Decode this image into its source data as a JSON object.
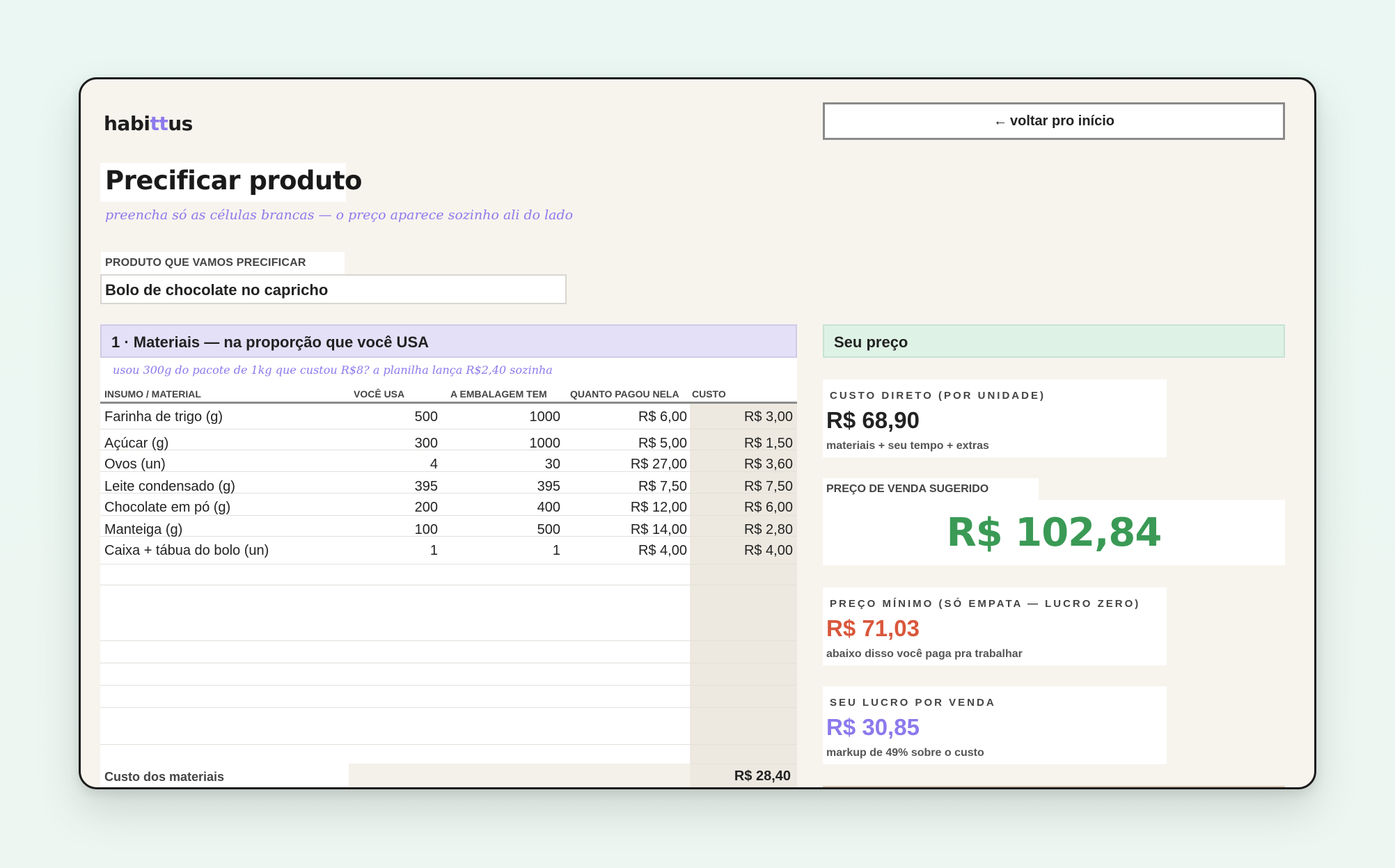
{
  "app": {
    "logo_prefix": "habi",
    "logo_highlight": "tt",
    "logo_suffix": "us",
    "back_button": "voltar pro início"
  },
  "page": {
    "title": "Precificar produto",
    "subtitle": "preencha só as células brancas — o preço aparece sozinho ali do lado"
  },
  "product": {
    "label": "PRODUTO QUE VAMOS PRECIFICAR",
    "value": "Bolo de chocolate no capricho"
  },
  "materials": {
    "heading": "1 · Materiais — na proporção que você USA",
    "hint": "usou 300g do pacote de 1kg que custou R$8? a planilha lança R$2,40 sozinha",
    "columns": {
      "insumo": "INSUMO / MATERIAL",
      "usa": "VOCÊ USA",
      "emb": "A EMBALAGEM TEM",
      "pago": "QUANTO PAGOU NELA",
      "custo": "CUSTO"
    },
    "rows": [
      {
        "name": "Farinha de trigo (g)",
        "usa": "500",
        "emb": "1000",
        "pago": "R$ 6,00",
        "custo": "R$ 3,00"
      },
      {
        "name": "Açúcar (g)",
        "usa": "300",
        "emb": "1000",
        "pago": "R$ 5,00",
        "custo": "R$ 1,50"
      },
      {
        "name": "Ovos (un)",
        "usa": "4",
        "emb": "30",
        "pago": "R$ 27,00",
        "custo": "R$ 3,60"
      },
      {
        "name": "Leite condensado (g)",
        "usa": "395",
        "emb": "395",
        "pago": "R$ 7,50",
        "custo": "R$ 7,50"
      },
      {
        "name": "Chocolate em pó (g)",
        "usa": "200",
        "emb": "400",
        "pago": "R$ 12,00",
        "custo": "R$ 6,00"
      },
      {
        "name": "Manteiga (g)",
        "usa": "100",
        "emb": "500",
        "pago": "R$ 14,00",
        "custo": "R$ 2,80"
      },
      {
        "name": "Caixa + tábua do bolo (un)",
        "usa": "1",
        "emb": "1",
        "pago": "R$ 4,00",
        "custo": "R$ 4,00"
      }
    ],
    "total_label": "Custo dos materiais",
    "total_value": "R$ 28,40"
  },
  "price": {
    "heading": "Seu preço",
    "direct_cost": {
      "label": "CUSTO DIRETO (POR UNIDADE)",
      "value": "R$ 68,90",
      "note": "materiais + seu tempo + extras"
    },
    "suggested": {
      "label": "PREÇO DE VENDA SUGERIDO",
      "value": "R$ 102,84"
    },
    "minimum": {
      "label": "PREÇO MÍNIMO (SÓ EMPATA — LUCRO ZERO)",
      "value": "R$ 71,03",
      "note": "abaixo disso você paga pra trabalhar"
    },
    "profit": {
      "label": "SEU LUCRO POR VENDA",
      "value": "R$ 30,85",
      "note": "markup de 49% sobre o custo"
    }
  },
  "colors": {
    "accent": "#8c79ec",
    "suggested_price": "#3a9a55",
    "minimum_price": "#d9573c",
    "profit": "#8c79ec",
    "materials_header": "#e4e0f8",
    "price_header": "#def2e5"
  }
}
